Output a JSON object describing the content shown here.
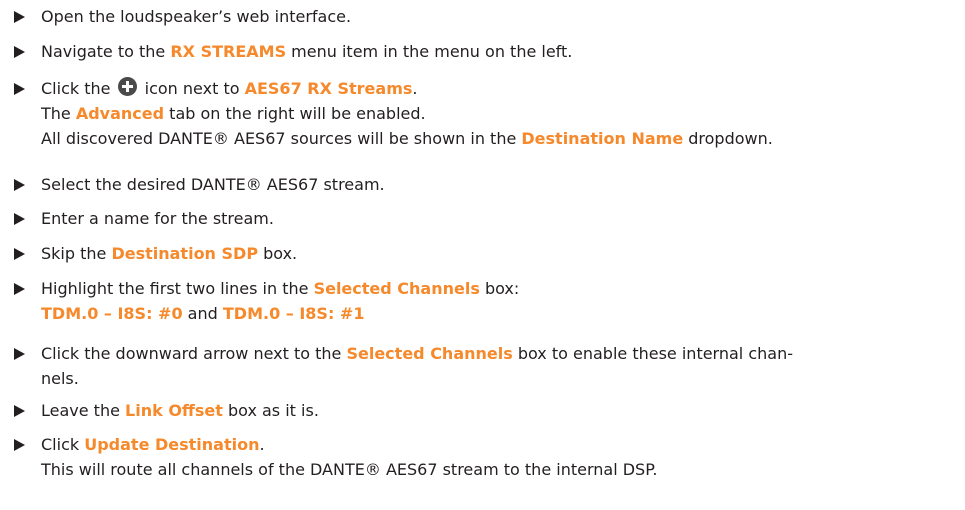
{
  "steps": [
    {
      "lines": [
        {
          "segments": [
            {
              "text": "Open the loudspeaker’s web interface."
            }
          ]
        }
      ]
    },
    {
      "lines": [
        {
          "segments": [
            {
              "text": "Navigate to the "
            },
            {
              "text": "RX STREAMS",
              "hl": true
            },
            {
              "text": " menu item in the menu on the left."
            }
          ]
        }
      ]
    },
    {
      "lines": [
        {
          "segments": [
            {
              "text": "Click the "
            },
            {
              "icon": "plus-icon"
            },
            {
              "text": " icon next to "
            },
            {
              "text": "AES67 RX Streams",
              "hl": true
            },
            {
              "text": "."
            }
          ]
        },
        {
          "segments": [
            {
              "text": "The "
            },
            {
              "text": "Advanced",
              "hl": true
            },
            {
              "text": " tab on the right will be enabled."
            }
          ]
        },
        {
          "segments": [
            {
              "text": "All discovered DANTE® AES67 sources will be shown in the "
            },
            {
              "text": "Destination Name",
              "hl": true
            },
            {
              "text": " dropdown."
            }
          ]
        }
      ]
    },
    {
      "lines": [
        {
          "segments": [
            {
              "text": "Select the desired DANTE® AES67 stream."
            }
          ]
        }
      ]
    },
    {
      "lines": [
        {
          "segments": [
            {
              "text": "Enter a name for the stream."
            }
          ]
        }
      ]
    },
    {
      "lines": [
        {
          "segments": [
            {
              "text": "Skip the "
            },
            {
              "text": "Destination SDP",
              "hl": true
            },
            {
              "text": " box."
            }
          ]
        }
      ]
    },
    {
      "lines": [
        {
          "segments": [
            {
              "text": "Highlight the first two lines in the "
            },
            {
              "text": "Selected Channels",
              "hl": true
            },
            {
              "text": " box:"
            }
          ]
        },
        {
          "segments": [
            {
              "text": "TDM.0 – I8S: #0",
              "hl": true
            },
            {
              "text": " and "
            },
            {
              "text": "TDM.0 – I8S: #1",
              "hl": true
            }
          ]
        }
      ]
    },
    {
      "lines": [
        {
          "segments": [
            {
              "text": "Click the downward arrow next to the "
            },
            {
              "text": "Selected Channels",
              "hl": true
            },
            {
              "text": " box to enable these internal chan-"
            }
          ]
        },
        {
          "segments": [
            {
              "text": "nels."
            }
          ]
        }
      ]
    },
    {
      "lines": [
        {
          "segments": [
            {
              "text": "Leave the "
            },
            {
              "text": "Link Offset",
              "hl": true
            },
            {
              "text": " box as it is."
            }
          ]
        }
      ]
    },
    {
      "lines": [
        {
          "segments": [
            {
              "text": "Click "
            },
            {
              "text": "Update Destination",
              "hl": true
            },
            {
              "text": "."
            }
          ]
        },
        {
          "segments": [
            {
              "text": "This will route all channels of the DANTE® AES67 stream to the internal DSP."
            }
          ]
        }
      ]
    }
  ]
}
